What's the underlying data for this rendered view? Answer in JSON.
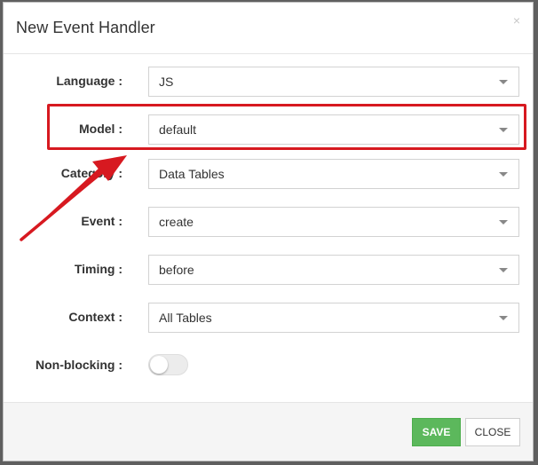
{
  "dialog": {
    "title": "New Event Handler",
    "close_glyph": "×"
  },
  "form": {
    "language": {
      "label": "Language :",
      "value": "JS"
    },
    "model": {
      "label": "Model :",
      "value": "default"
    },
    "category": {
      "label": "Category :",
      "value": "Data Tables"
    },
    "event": {
      "label": "Event :",
      "value": "create"
    },
    "timing": {
      "label": "Timing :",
      "value": "before"
    },
    "context": {
      "label": "Context :",
      "value": "All Tables"
    },
    "non_blocking": {
      "label": "Non-blocking :",
      "enabled": false
    }
  },
  "footer": {
    "save_label": "SAVE",
    "close_label": "CLOSE"
  },
  "annotation": {
    "highlight_color": "#d71920"
  },
  "colors": {
    "save_button": "#5cb85c",
    "backdrop": "#6f6f6f"
  }
}
